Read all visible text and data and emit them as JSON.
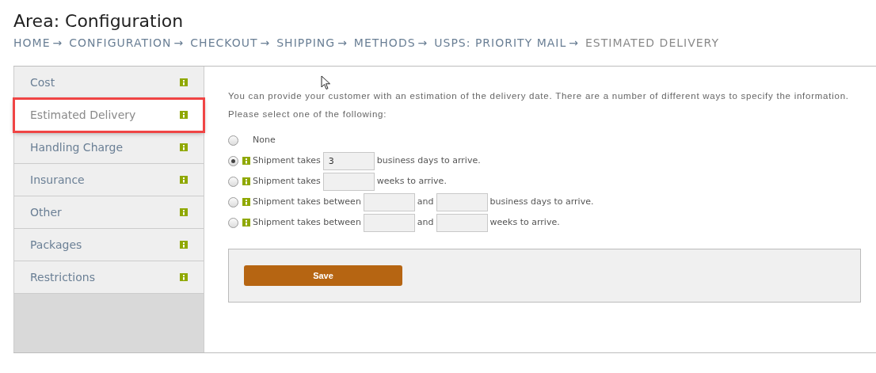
{
  "page": {
    "title": "Area: Configuration"
  },
  "breadcrumb": [
    {
      "label": "HOME",
      "arrow": "→",
      "current": false
    },
    {
      "label": "CONFIGURATION",
      "arrow": "→",
      "current": false
    },
    {
      "label": "CHECKOUT",
      "arrow": "→",
      "current": false
    },
    {
      "label": "SHIPPING",
      "arrow": "→",
      "current": false
    },
    {
      "label": "METHODS",
      "arrow": "→",
      "current": false
    },
    {
      "label": "USPS: PRIORITY MAIL",
      "arrow": "→",
      "current": false
    },
    {
      "label": "ESTIMATED DELIVERY",
      "current": true
    }
  ],
  "sidebar": {
    "items": [
      {
        "label": "Cost",
        "selected": false,
        "highlighted": false
      },
      {
        "label": "Estimated Delivery",
        "selected": true,
        "highlighted": true
      },
      {
        "label": "Handling Charge",
        "selected": false,
        "highlighted": false
      },
      {
        "label": "Insurance",
        "selected": false,
        "highlighted": false
      },
      {
        "label": "Other",
        "selected": false,
        "highlighted": false
      },
      {
        "label": "Packages",
        "selected": false,
        "highlighted": false
      },
      {
        "label": "Restrictions",
        "selected": false,
        "highlighted": false
      }
    ]
  },
  "intro": [
    "You can provide your customer with an estimation of the delivery date. There are a number of different ways to specify the information.",
    "Please select one of the following:"
  ],
  "options": [
    {
      "selected": false,
      "info": false,
      "parts": [
        {
          "kind": "text",
          "text": "None"
        }
      ]
    },
    {
      "selected": true,
      "info": true,
      "parts": [
        {
          "kind": "text",
          "text": "Shipment takes"
        },
        {
          "kind": "field",
          "value": "3"
        },
        {
          "kind": "text",
          "text": "business days to arrive."
        }
      ]
    },
    {
      "selected": false,
      "info": true,
      "parts": [
        {
          "kind": "text",
          "text": "Shipment takes"
        },
        {
          "kind": "field"
        },
        {
          "kind": "text",
          "text": "weeks to arrive."
        }
      ]
    },
    {
      "selected": false,
      "info": true,
      "parts": [
        {
          "kind": "text",
          "text": "Shipment takes between"
        },
        {
          "kind": "field"
        },
        {
          "kind": "text",
          "text": "and"
        },
        {
          "kind": "field"
        },
        {
          "kind": "text",
          "text": "business days to arrive."
        }
      ]
    },
    {
      "selected": false,
      "info": true,
      "parts": [
        {
          "kind": "text",
          "text": "Shipment takes between"
        },
        {
          "kind": "field"
        },
        {
          "kind": "text",
          "text": "and"
        },
        {
          "kind": "field"
        },
        {
          "kind": "text",
          "text": "weeks to arrive."
        }
      ]
    }
  ],
  "save_button": "Save"
}
